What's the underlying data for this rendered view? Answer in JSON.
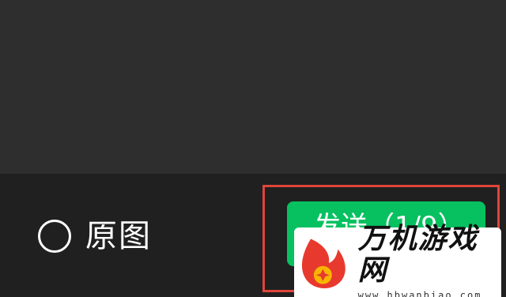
{
  "bottom_bar": {
    "original_label": "原图",
    "original_checked": false,
    "send_button_label": "发送（1/9）"
  },
  "watermark": {
    "title": "万机游戏网",
    "url": "www.hbwanbiao.com"
  },
  "colors": {
    "send_button": "#07c160",
    "highlight_border": "#e0453a",
    "bar_background": "#202020",
    "preview_background": "#2e2e2e",
    "logo_red": "#e8392e",
    "logo_yellow": "#f7b500"
  },
  "icons": {
    "radio": "empty-circle",
    "logo": "flame-logo"
  }
}
